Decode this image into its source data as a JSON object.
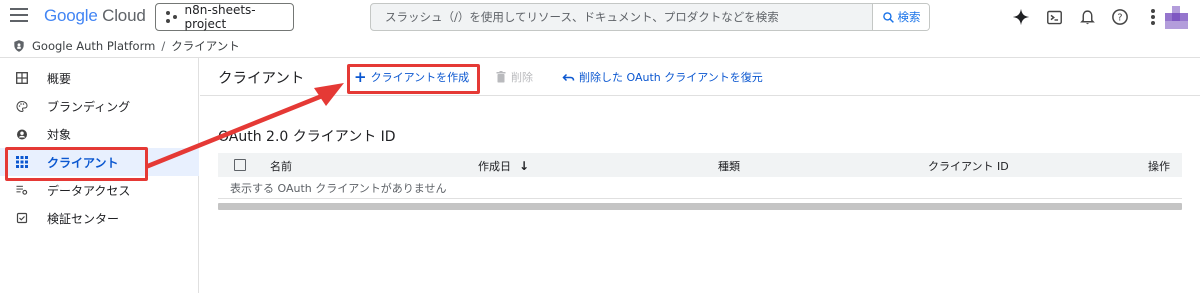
{
  "header": {
    "logo_google": "Google",
    "logo_cloud": "Cloud",
    "project_name": "n8n-sheets-project",
    "search_placeholder": "スラッシュ（/）を使用してリソース、ドキュメント、プロダクトなどを検索",
    "search_button": "検索",
    "icons": [
      "gemini-icon",
      "cloud-shell-icon",
      "bell-icon",
      "help-icon",
      "more-vert-icon"
    ]
  },
  "breadcrumb": {
    "root": "Google Auth Platform",
    "separator": "/",
    "current": "クライアント"
  },
  "sidebar": {
    "items": [
      {
        "label": "概要",
        "icon": "dashboard-icon"
      },
      {
        "label": "ブランディング",
        "icon": "palette-icon"
      },
      {
        "label": "対象",
        "icon": "person-icon"
      },
      {
        "label": "クライアント",
        "icon": "grid-icon",
        "active": true
      },
      {
        "label": "データアクセス",
        "icon": "data-settings-icon"
      },
      {
        "label": "検証センター",
        "icon": "verify-icon"
      }
    ]
  },
  "main": {
    "title": "クライアント",
    "create_label": "クライアントを作成",
    "delete_label": "削除",
    "restore_label": "削除した OAuth クライアントを復元",
    "section_title": "OAuth 2.0 クライアント ID",
    "columns": [
      "名前",
      "作成日",
      "種類",
      "クライアント ID",
      "操作"
    ],
    "empty_message": "表示する OAuth クライアントがありません"
  },
  "colors": {
    "accent": "#0b57d0",
    "annotation": "#e53935",
    "active_bg": "#e8f0fe"
  }
}
